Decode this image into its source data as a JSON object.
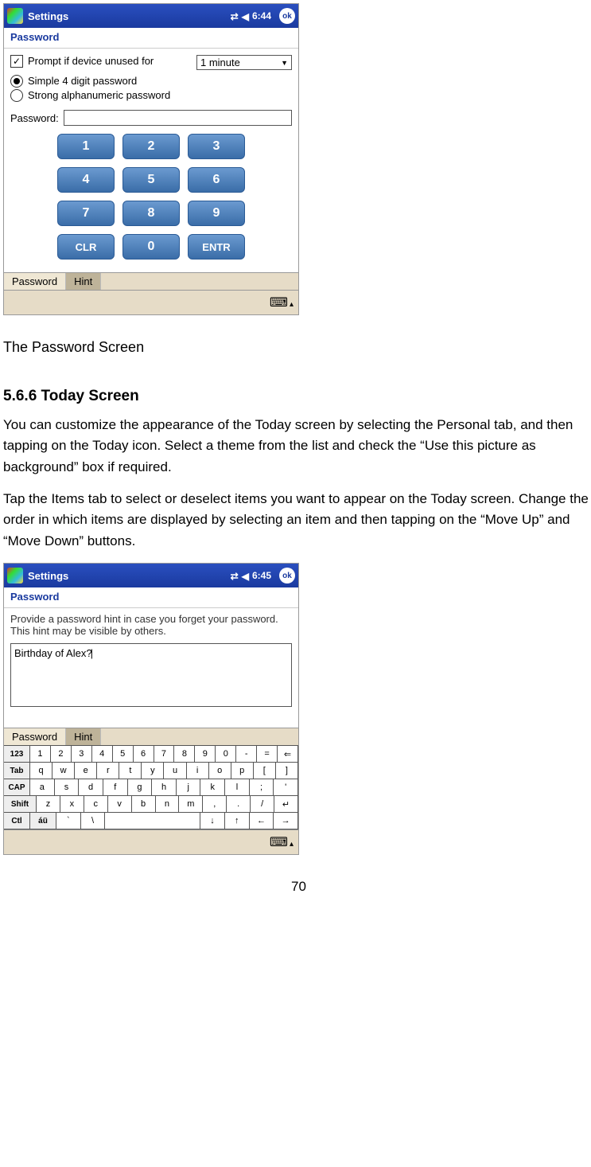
{
  "screenshot1": {
    "titlebar": {
      "title": "Settings",
      "clock": "6:44",
      "ok": "ok"
    },
    "header": "Password",
    "prompt_checkbox": {
      "label": "Prompt if device unused for",
      "checked": "✓"
    },
    "dropdown_value": "1 minute",
    "radio_simple": "Simple 4 digit password",
    "radio_strong": "Strong alphanumeric password",
    "password_label": "Password:",
    "keypad": [
      "1",
      "2",
      "3",
      "4",
      "5",
      "6",
      "7",
      "8",
      "9",
      "CLR",
      "0",
      "ENTR"
    ],
    "tabs": {
      "password": "Password",
      "hint": "Hint"
    }
  },
  "caption1": "The Password Screen",
  "section": {
    "title": "5.6.6 Today Screen",
    "p1": "You can customize the appearance of the Today screen by selecting the Personal tab, and then tapping on the Today icon. Select a theme from the list and check the “Use this picture as background” box if required.",
    "p2": "Tap the Items tab to select or deselect items you want to appear on the Today screen. Change the order in which items are displayed by selecting an item and then tapping on the “Move Up” and “Move Down” buttons."
  },
  "screenshot2": {
    "titlebar": {
      "title": "Settings",
      "clock": "6:45",
      "ok": "ok"
    },
    "header": "Password",
    "hint_instructions": "Provide a password hint in case you forget your password.  This hint may be visible by others.",
    "hint_value": "Birthday of Alex?",
    "tabs": {
      "password": "Password",
      "hint": "Hint"
    },
    "osk": {
      "r1": [
        "123",
        "1",
        "2",
        "3",
        "4",
        "5",
        "6",
        "7",
        "8",
        "9",
        "0",
        "-",
        "="
      ],
      "r2": [
        "Tab",
        "q",
        "w",
        "e",
        "r",
        "t",
        "y",
        "u",
        "i",
        "o",
        "p",
        "[",
        "]"
      ],
      "r3": [
        "CAP",
        "a",
        "s",
        "d",
        "f",
        "g",
        "h",
        "j",
        "k",
        "l",
        ";",
        "'"
      ],
      "r4": [
        "Shift",
        "z",
        "x",
        "c",
        "v",
        "b",
        "n",
        "m",
        ",",
        ".",
        "/"
      ],
      "r5": [
        "Ctl",
        "áü",
        "`",
        "\\",
        " "
      ]
    }
  },
  "page_number": "70"
}
